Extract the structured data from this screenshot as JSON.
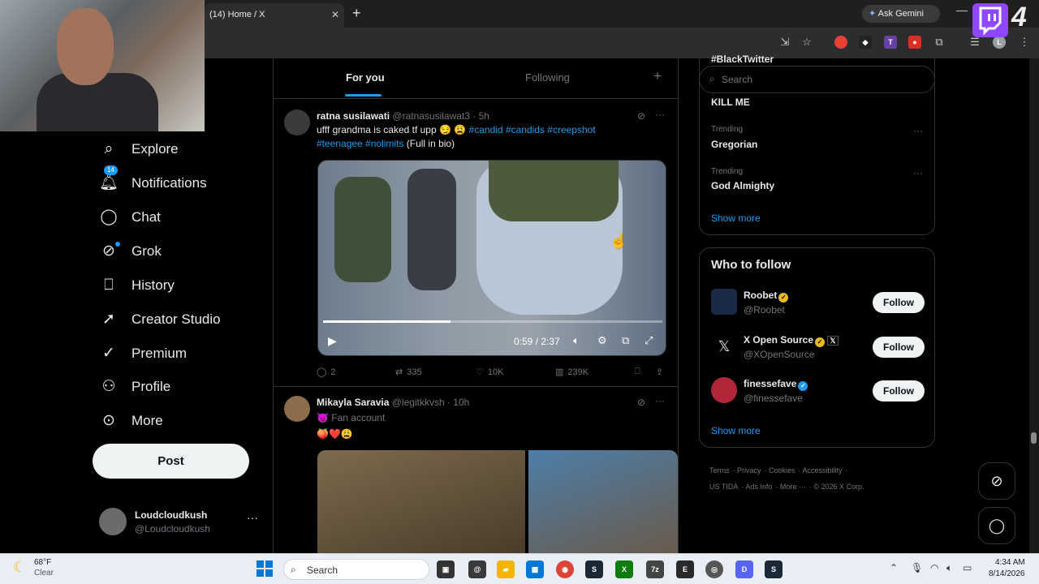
{
  "browser": {
    "tab_title": "(14) Home / X",
    "tab_close": "✕",
    "new_tab": "+",
    "gemini_label": "Ask Gemini",
    "minimize": "—"
  },
  "overlay": {
    "stream_number": "4"
  },
  "nav": {
    "items": [
      {
        "label": "Explore",
        "icon": "search-icon"
      },
      {
        "label": "Notifications",
        "icon": "bell-icon",
        "badge": "14"
      },
      {
        "label": "Chat",
        "icon": "chat-icon"
      },
      {
        "label": "Grok",
        "icon": "grok-icon"
      },
      {
        "label": "History",
        "icon": "bookmark-icon"
      },
      {
        "label": "Creator Studio",
        "icon": "rocket-icon"
      },
      {
        "label": "Premium",
        "icon": "verified-icon"
      },
      {
        "label": "Profile",
        "icon": "person-icon"
      },
      {
        "label": "More",
        "icon": "more-circle-icon"
      }
    ],
    "post_label": "Post",
    "account": {
      "name": "Loudcloudkush",
      "handle": "@Loudcloudkush",
      "more": "···"
    }
  },
  "feed": {
    "tabs": [
      "For you",
      "Following"
    ],
    "plus": "+",
    "tweets": [
      {
        "name": "ratna susilawati",
        "handle": "@ratnasusilawat3 · 5h",
        "text_plain": "ufff grandma is caked tf upp 😏 😩 ",
        "hashtags_line1": "#candid #candids #creepshot",
        "hashtags_line2": "#teenagee #nolimits",
        "text_tail": " (Full in bio)",
        "video": {
          "time": "0:59 / 2:37",
          "progress": 0.376
        },
        "actions": {
          "replies": "2",
          "reposts": "335",
          "likes": "10K",
          "views": "239K"
        }
      },
      {
        "name": "Mikayla Saravia",
        "handle": "@legitkkvsh · 10h",
        "subtitle": "😈 Fan account",
        "text": "🍑❤️😩"
      }
    ]
  },
  "sidebar": {
    "search_placeholder": "Search",
    "partial_trend": "#BlackTwitter",
    "trends": [
      {
        "context": "",
        "name": "KILL ME"
      },
      {
        "context": "Trending",
        "name": "Gregorian"
      },
      {
        "context": "Trending",
        "name": "God Almighty"
      }
    ],
    "trends_show_more": "Show more",
    "who_to_follow": {
      "title": "Who to follow",
      "accounts": [
        {
          "name": "Roobet",
          "handle": "@Roobet",
          "badge_color": "#e8b923"
        },
        {
          "name": "X Open Source",
          "handle": "@XOpenSource",
          "badge_color": "#e8b923",
          "affiliate": "𝕏"
        },
        {
          "name": "finessefave",
          "handle": "@finessefave",
          "badge_color": "#1d9bf0"
        }
      ],
      "follow_label": "Follow",
      "show_more": "Show more"
    },
    "footer": {
      "line1": [
        "Terms",
        "Privacy",
        "Cookies",
        "Accessibility"
      ],
      "line2": [
        "US TIDA",
        "Ads Info",
        "More ···",
        "© 2026 X Corp."
      ]
    }
  },
  "taskbar": {
    "weather_temp": "68°F",
    "weather_desc": "Clear",
    "search_label": "Search",
    "time": "4:34 AM",
    "date": "8/14/2026"
  },
  "colors": {
    "accent": "#1d9bf0",
    "twitch": "#9146ff"
  }
}
